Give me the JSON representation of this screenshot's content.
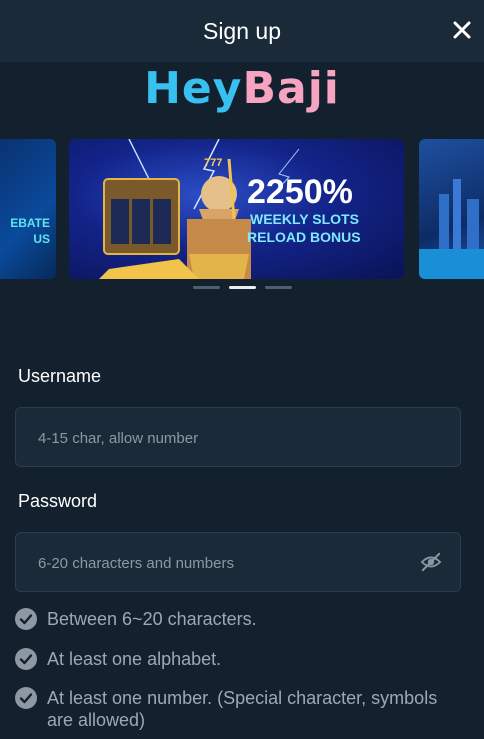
{
  "header": {
    "title": "Sign up"
  },
  "logo": {
    "part1": "Hey",
    "part2": "Baji"
  },
  "carousel": {
    "left_text_1": "EBATE",
    "left_text_2": "US",
    "center": {
      "big": "2250%",
      "line1": "WEEKLY SLOTS",
      "line2": "RELOAD BONUS"
    },
    "active_index": 1,
    "count": 3
  },
  "form": {
    "username": {
      "label": "Username",
      "placeholder": "4-15 char, allow number"
    },
    "password": {
      "label": "Password",
      "placeholder": "6-20 characters and numbers"
    }
  },
  "rules": [
    "Between 6~20 characters.",
    "At least one alphabet.",
    "At least one number. (Special character, symbols are allowed)"
  ],
  "colors": {
    "background": "#13212e",
    "header": "#1b2a38",
    "accent_blue": "#38c1f0",
    "accent_pink": "#f6a4bf"
  }
}
